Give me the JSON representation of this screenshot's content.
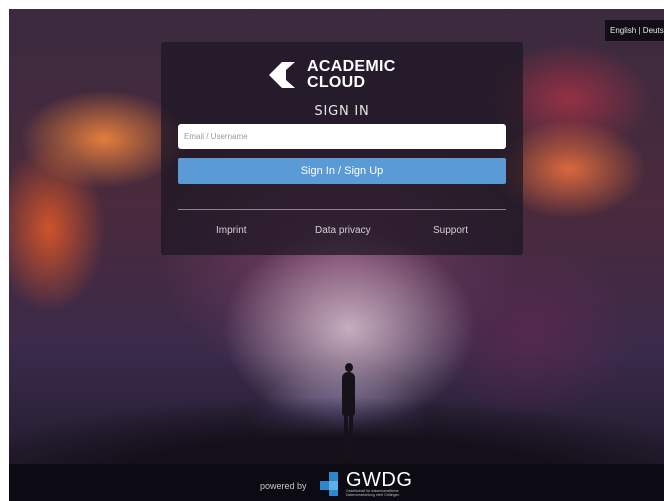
{
  "header": {
    "lang_en": "English",
    "lang_sep": "|",
    "lang_de": "Deutsch"
  },
  "login": {
    "logo_line1": "ACADEMIC",
    "logo_line2": "CLOUD",
    "title": "SIGN IN",
    "email_placeholder": "Email / Username",
    "email_value": "",
    "submit_label": "Sign In / Sign Up",
    "links": [
      "Imprint",
      "Data privacy",
      "Support"
    ]
  },
  "footer": {
    "powered_by": "powered by",
    "brand_name": "GWDG",
    "brand_sub_line1": "Gesellschaft für wissenschaftliche",
    "brand_sub_line2": "Datenverarbeitung mbH Göttingen"
  },
  "colors": {
    "accent": "#5b9bd5",
    "panel": "#1c1622",
    "gwdg_blue": "#2d87c8"
  },
  "icons": [
    "academic-cloud-logo-icon",
    "gwdg-logo-icon"
  ]
}
